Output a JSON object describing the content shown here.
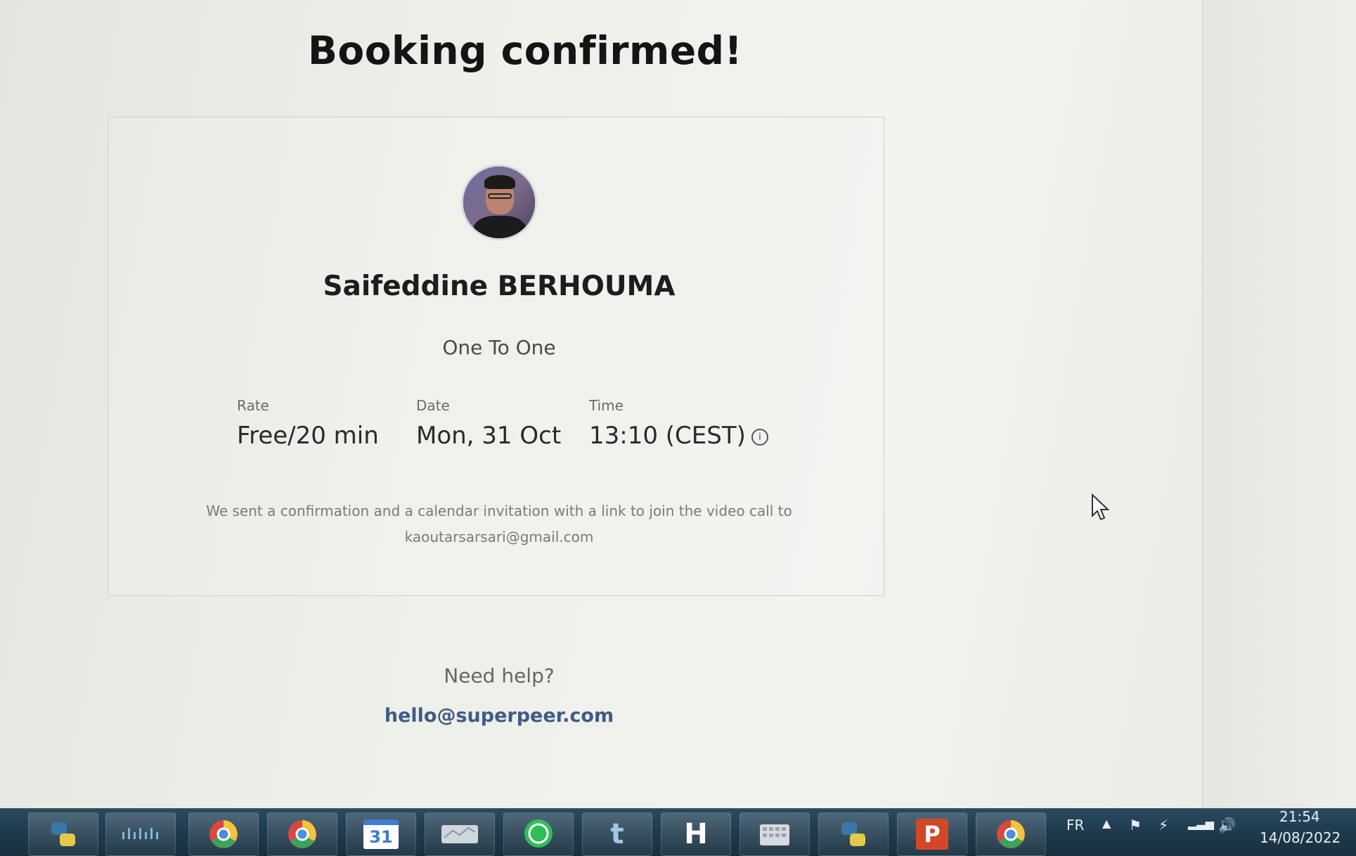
{
  "page": {
    "title": "Booking confirmed!"
  },
  "host": {
    "name": "Saifeddine BERHOUMA",
    "session_type": "One To One"
  },
  "details": {
    "rate_label": "Rate",
    "rate_value": "Free/20 min",
    "date_label": "Date",
    "date_value": "Mon, 31 Oct",
    "time_label": "Time",
    "time_value": "13:10 (CEST)"
  },
  "confirmation": {
    "message": "We sent a confirmation and a calendar invitation with a link to join the video call to",
    "email": "kaoutarsarsari@gmail.com"
  },
  "help": {
    "label": "Need help?",
    "email": "hello@superpeer.com"
  },
  "taskbar": {
    "items": [
      {
        "icon": "python-icon",
        "glyph": ""
      },
      {
        "icon": "cisco-icon",
        "glyph": ""
      },
      {
        "icon": "chrome-profile-icon",
        "glyph": ""
      },
      {
        "icon": "chrome-icon",
        "glyph": ""
      },
      {
        "icon": "calendar-icon",
        "glyph": "31"
      },
      {
        "icon": "app-icon",
        "glyph": ""
      },
      {
        "icon": "whatsapp-icon",
        "glyph": ""
      },
      {
        "icon": "tumblr-icon",
        "glyph": "t"
      },
      {
        "icon": "h-app-icon",
        "glyph": "H"
      },
      {
        "icon": "keyboard-app-icon",
        "glyph": ""
      },
      {
        "icon": "python-file-icon",
        "glyph": ""
      },
      {
        "icon": "powerpoint-icon",
        "glyph": "P"
      },
      {
        "icon": "chrome-notify-icon",
        "glyph": ""
      }
    ],
    "language": "FR",
    "time": "21:54",
    "date": "14/08/2022"
  }
}
